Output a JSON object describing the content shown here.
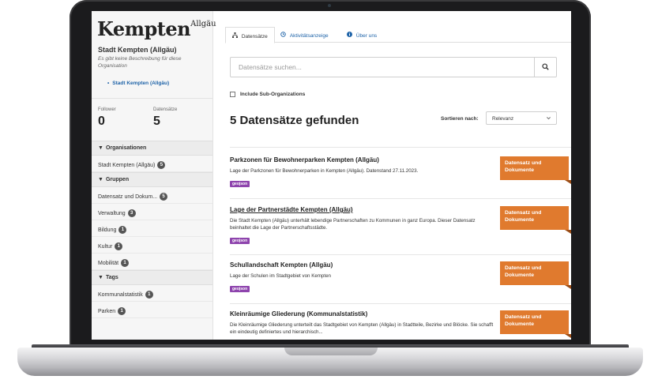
{
  "brand": {
    "name": "Kempten",
    "suffix": "Allgäu"
  },
  "organization": {
    "name": "Stadt Kempten (Allgäu)",
    "description": "Es gibt keine Beschreibung für diese Organisation",
    "link": "Stadt Kempten (Allgäu)",
    "followers_label": "Follower",
    "followers": "0",
    "datasets_label": "Datensätze",
    "datasets": "5"
  },
  "facets": {
    "organisations": {
      "title": "Organisationen",
      "items": [
        {
          "label": "Stadt Kempten (Allgäu)",
          "count": "5"
        }
      ]
    },
    "groups": {
      "title": "Gruppen",
      "items": [
        {
          "label": "Datensatz und Dokum...",
          "count": "5"
        },
        {
          "label": "Verwaltung",
          "count": "3"
        },
        {
          "label": "Bildung",
          "count": "1"
        },
        {
          "label": "Kultur",
          "count": "1"
        },
        {
          "label": "Mobilität",
          "count": "1"
        }
      ]
    },
    "tags": {
      "title": "Tags",
      "items": [
        {
          "label": "Kommunalstatistik",
          "count": "1"
        },
        {
          "label": "Parken",
          "count": "1"
        }
      ]
    }
  },
  "tabs": [
    {
      "label": "Datensätze",
      "icon": "sitemap-icon"
    },
    {
      "label": "Aktivitätsanzeige",
      "icon": "clock-icon"
    },
    {
      "label": "Über uns",
      "icon": "info-icon"
    }
  ],
  "search": {
    "placeholder": "Datensätze suchen..."
  },
  "sub_org_label": "Include Sub-Organizations",
  "results_count": "5 Datensätze gefunden",
  "sort": {
    "label": "Sortieren nach:",
    "value": "Relevanz"
  },
  "datasets": [
    {
      "title": "Parkzonen für Bewohnerparken Kempten (Allgäu)",
      "description": "Lage der Parkzonen für Bewohnerparken in Kempten (Allgäu). Datenstand 27.11.2023.",
      "format": "geojson",
      "ribbon": "Datensatz und Dokumente"
    },
    {
      "title": "Lage der Partnerstädte Kempten (Allgäu)",
      "description": "Die Stadt Kempten (Allgäu) unterhält lebendige Partnerschaften zu Kommunen in ganz Europa. Dieser Datensatz beinhaltet die Lage der Partnerschaftsstädte.",
      "format": "geojson",
      "ribbon": "Datensatz und Dokumente"
    },
    {
      "title": "Schullandschaft Kempten (Allgäu)",
      "description": "Lage der Schulen im Stadtgebiet von Kempten",
      "format": "geojson",
      "ribbon": "Datensatz und Dokumente"
    },
    {
      "title": "Kleinräumige Gliederung (Kommunalstatistik)",
      "description": "Die Kleinräumige Gliederung unterteilt das Stadtgebiet von Kempten (Allgäu) in Stadtteile, Bezirke und Blöcke. Sie schafft ein eindeutig definiertes und hierarchisch...",
      "format": "",
      "ribbon": "Datensatz und Dokumente"
    }
  ]
}
